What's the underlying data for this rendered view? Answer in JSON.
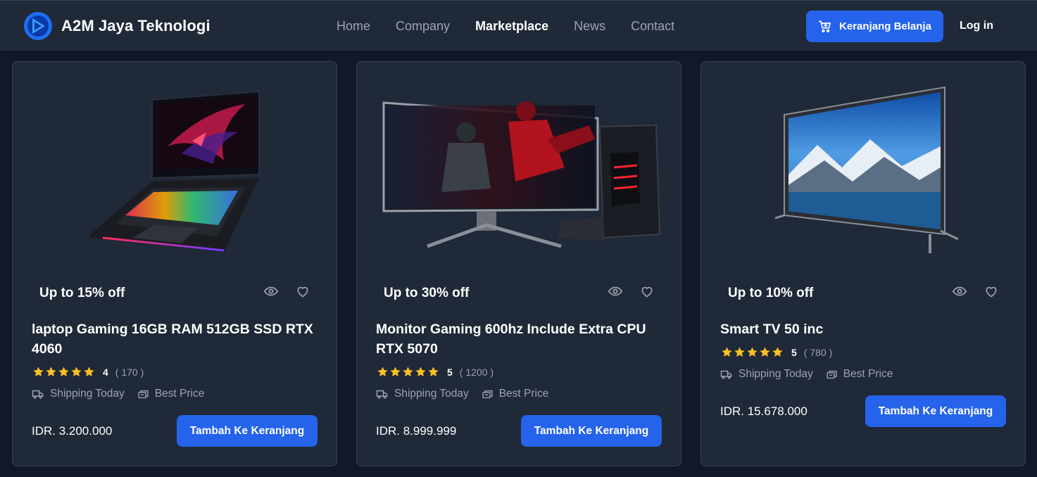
{
  "header": {
    "brand": "A2M Jaya Teknologi",
    "nav": [
      "Home",
      "Company",
      "Marketplace",
      "News",
      "Contact"
    ],
    "active_nav": "Marketplace",
    "cart_label": "Keranjang Belanja",
    "login_label": "Log in"
  },
  "colors": {
    "background": "#111827",
    "card": "#1f2937",
    "accent": "#2563eb",
    "star": "#fbbf24",
    "muted": "#9ca3af"
  },
  "products": [
    {
      "image": "gaming-laptop",
      "discount": "Up to 15% off",
      "title": "laptop Gaming 16GB RAM 512GB SSD RTX 4060",
      "rating": "4",
      "reviews": "( 170 )",
      "features": [
        "Shipping Today",
        "Best Price"
      ],
      "price": "IDR. 3.200.000",
      "button": "Tambah Ke Keranjang"
    },
    {
      "image": "gaming-monitor-with-pc",
      "discount": "Up to 30% off",
      "title": "Monitor Gaming 600hz Include Extra CPU RTX 5070",
      "rating": "5",
      "reviews": "( 1200 )",
      "features": [
        "Shipping Today",
        "Best Price"
      ],
      "price": "IDR. 8.999.999",
      "button": "Tambah Ke Keranjang"
    },
    {
      "image": "smart-tv",
      "discount": "Up to 10% off",
      "title": "Smart TV 50 inc",
      "rating": "5",
      "reviews": "( 780 )",
      "features": [
        "Shipping Today",
        "Best Price"
      ],
      "price": "IDR. 15.678.000",
      "button": "Tambah Ke Keranjang"
    }
  ]
}
